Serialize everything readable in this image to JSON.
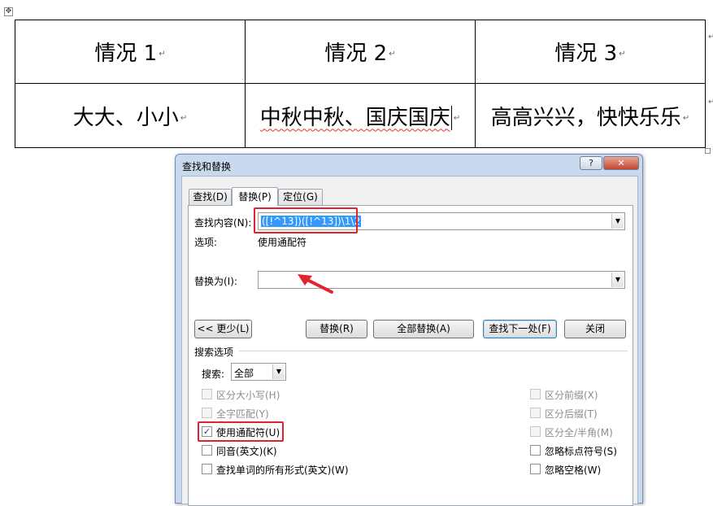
{
  "doc_table": {
    "headers": [
      "情况 1",
      "情况 2",
      "情况 3"
    ],
    "cells": [
      {
        "plain": "大大、小小",
        "squiggle": ""
      },
      {
        "plain": "",
        "squiggle": "中秋中秋、国庆国庆"
      },
      {
        "plain": "高高兴兴，快快乐乐",
        "squiggle": ""
      }
    ],
    "paragraph_mark": "↵",
    "table_handle": "✥"
  },
  "dialog": {
    "title": "查找和替换",
    "help_label": "?",
    "close_label": "✕",
    "tabs": [
      "查找(D)",
      "替换(P)",
      "定位(G)"
    ],
    "find_label": "查找内容(N):",
    "find_value": "([!^13])([!^13])\\1\\2",
    "options_label": "选项:",
    "options_value": "使用通配符",
    "replace_label": "替换为(I):",
    "replace_value": "",
    "buttons": {
      "less": "<< 更少(L)",
      "replace": "替换(R)",
      "replace_all": "全部替换(A)",
      "find_next": "查找下一处(F)",
      "close": "关闭"
    },
    "search_options_title": "搜索选项",
    "search_label": "搜索:",
    "search_value": "全部",
    "left_options": [
      {
        "label": "区分大小写(H)",
        "checked": false,
        "disabled": true
      },
      {
        "label": "全字匹配(Y)",
        "checked": false,
        "disabled": true
      },
      {
        "label": "使用通配符(U)",
        "checked": true,
        "disabled": false
      },
      {
        "label": "同音(英文)(K)",
        "checked": false,
        "disabled": false
      },
      {
        "label": "查找单词的所有形式(英文)(W)",
        "checked": false,
        "disabled": false
      }
    ],
    "right_options": [
      {
        "label": "区分前缀(X)",
        "checked": false,
        "disabled": true
      },
      {
        "label": "区分后缀(T)",
        "checked": false,
        "disabled": true
      },
      {
        "label": "区分全/半角(M)",
        "checked": false,
        "disabled": true
      },
      {
        "label": "忽略标点符号(S)",
        "checked": false,
        "disabled": false
      },
      {
        "label": "忽略空格(W)",
        "checked": false,
        "disabled": false
      }
    ],
    "check_mark": "✓",
    "dropdown_arrow": "▼"
  },
  "colors": {
    "highlight_box": "#e3232b",
    "selection": "#3399ff",
    "spell_squiggle": "#e0302e"
  }
}
